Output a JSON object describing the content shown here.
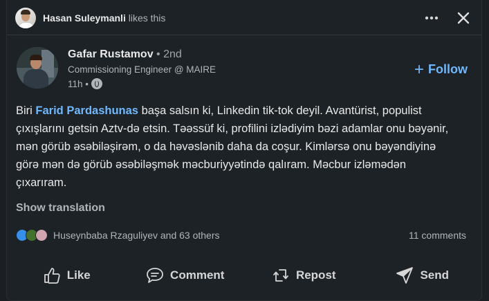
{
  "social_context": {
    "actor": "Hasan Suleymanli",
    "action": "likes this"
  },
  "author": {
    "name": "Gafar Rustamov",
    "degree": "• 2nd",
    "headline": "Commissioning Engineer @ MAIRE",
    "time": "11h •",
    "visibility_icon": "globe-icon"
  },
  "follow": {
    "label": "Follow"
  },
  "post": {
    "prefix": "Biri ",
    "mention": "Farid Pardashunas",
    "text": " başa salsın ki, Linkedin tik-tok deyil. Avantürist, populist çıxışlarını getsin Aztv-də etsin. Təəssüf ki, profilini izlədiyim bəzi adamlar onu bəyənir, mən görüb əsəbiləşirəm, o da həvəslənib daha da coşur. Kimlərsə onu bəyəndiyinə görə mən də görüb əsəbiləşmək məcburiyyətində qalıram. Məcbur izləmədən çıxarıram."
  },
  "show_translation": "Show translation",
  "reactions": {
    "summary": "Huseynbaba Rzaguliyev and 63 others",
    "comments": "11 comments",
    "icons": [
      "like-reaction-icon",
      "celebrate-reaction-icon",
      "support-reaction-icon"
    ]
  },
  "actions": {
    "like": "Like",
    "comment": "Comment",
    "repost": "Repost",
    "send": "Send"
  },
  "colors": {
    "background": "#1b1f23",
    "card": "#1d2226",
    "accent": "#71b7fb",
    "text": "#e9e9e9",
    "muted": "#b0b5b9"
  }
}
